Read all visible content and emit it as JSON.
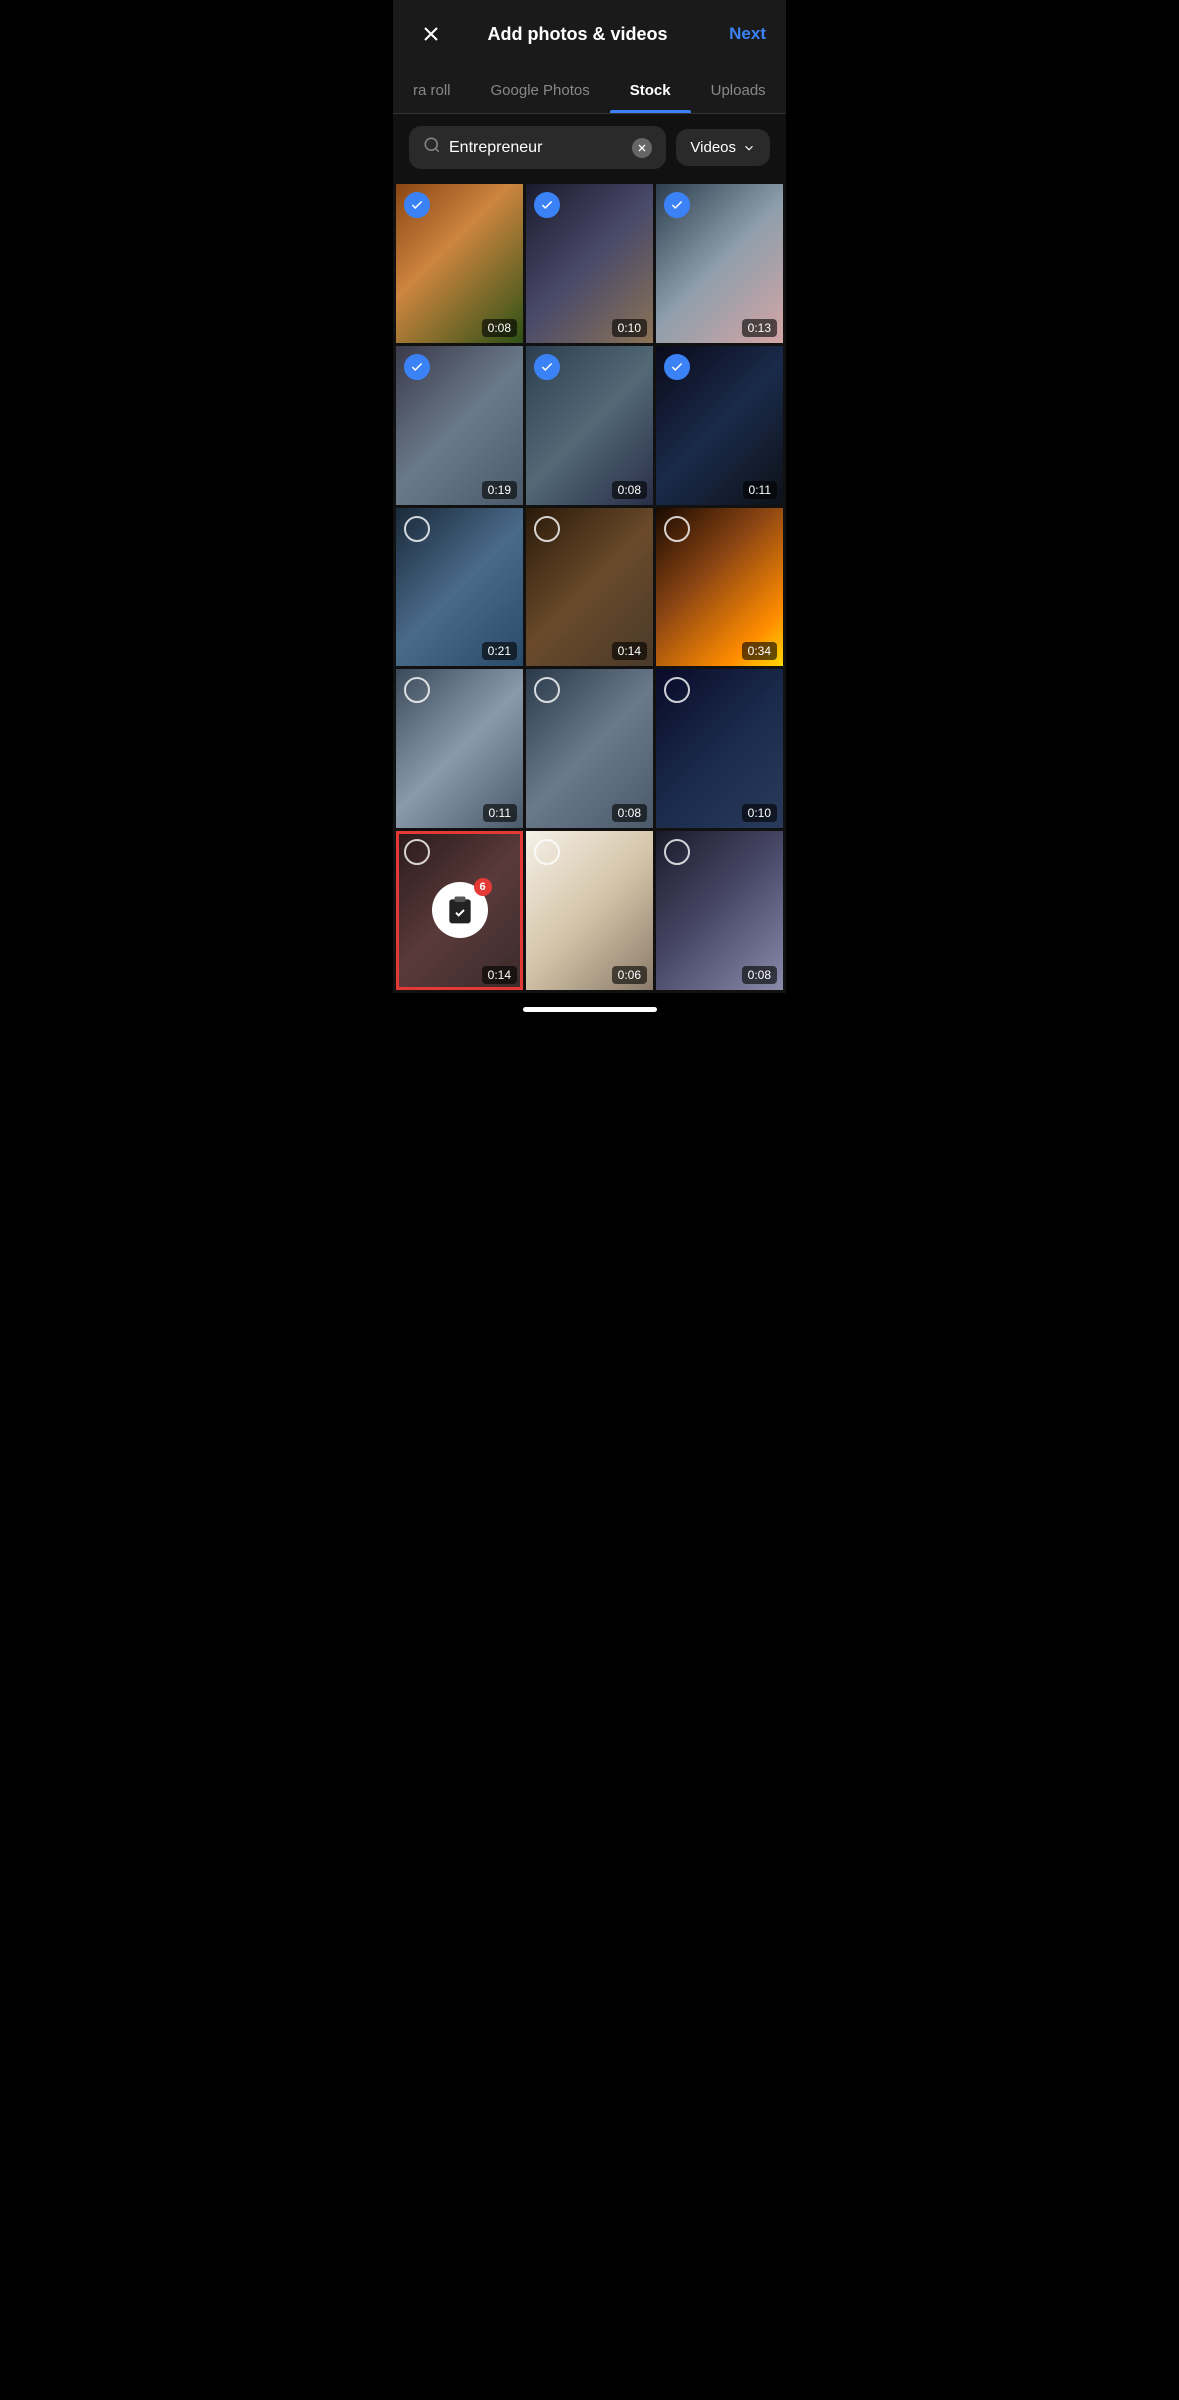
{
  "header": {
    "title": "Add photos & videos",
    "next_label": "Next",
    "close_label": "Close"
  },
  "tabs": [
    {
      "id": "camera-roll",
      "label": "ra roll",
      "active": false
    },
    {
      "id": "google-photos",
      "label": "Google Photos",
      "active": false
    },
    {
      "id": "stock",
      "label": "Stock",
      "active": true
    },
    {
      "id": "uploads",
      "label": "Uploads",
      "active": false
    }
  ],
  "search": {
    "value": "Entrepreneur",
    "placeholder": "Search"
  },
  "filter": {
    "label": "Videos"
  },
  "grid": {
    "items": [
      {
        "id": 1,
        "duration": "0:08",
        "selected": true,
        "active_selection": false,
        "img_class": "img-warm-cafe"
      },
      {
        "id": 2,
        "duration": "0:10",
        "selected": true,
        "active_selection": false,
        "img_class": "img-office-dark"
      },
      {
        "id": 3,
        "duration": "0:13",
        "selected": true,
        "active_selection": false,
        "img_class": "img-office-meeting"
      },
      {
        "id": 4,
        "duration": "0:19",
        "selected": true,
        "active_selection": false,
        "img_class": "img-office-wheelchair"
      },
      {
        "id": 5,
        "duration": "0:08",
        "selected": true,
        "active_selection": false,
        "img_class": "img-man-smiling"
      },
      {
        "id": 6,
        "duration": "0:11",
        "selected": true,
        "active_selection": false,
        "img_class": "img-code-screen"
      },
      {
        "id": 7,
        "duration": "0:21",
        "selected": false,
        "active_selection": false,
        "img_class": "img-businessman-phone"
      },
      {
        "id": 8,
        "duration": "0:14",
        "selected": false,
        "active_selection": false,
        "img_class": "img-man-cafe"
      },
      {
        "id": 9,
        "duration": "0:34",
        "selected": false,
        "active_selection": false,
        "img_class": "img-silhouette-sunset"
      },
      {
        "id": 10,
        "duration": "0:11",
        "selected": false,
        "active_selection": false,
        "img_class": "img-woman-paper"
      },
      {
        "id": 11,
        "duration": "0:08",
        "selected": false,
        "active_selection": false,
        "img_class": "img-meeting-board"
      },
      {
        "id": 12,
        "duration": "0:10",
        "selected": false,
        "active_selection": false,
        "img_class": "img-woman-office-night"
      },
      {
        "id": 13,
        "duration": "0:14",
        "selected": false,
        "active_selection": true,
        "has_clipboard": true,
        "clipboard_count": 6,
        "img_class": "img-man-beard"
      },
      {
        "id": 14,
        "duration": "0:06",
        "selected": false,
        "active_selection": false,
        "img_class": "img-woman-laptop"
      },
      {
        "id": 15,
        "duration": "0:08",
        "selected": false,
        "active_selection": false,
        "img_class": "img-glasses-close"
      }
    ]
  }
}
